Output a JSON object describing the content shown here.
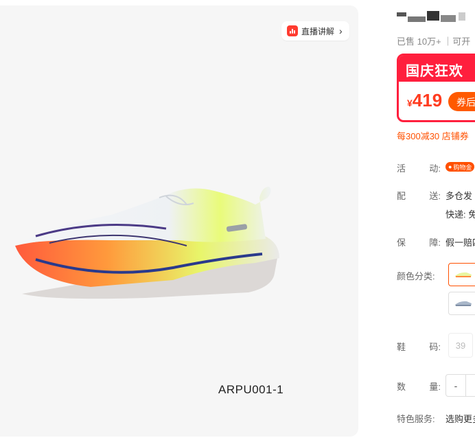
{
  "live_button": {
    "label": "直播讲解",
    "icon": "live-chart-icon",
    "arrow_icon": "chevron-right-icon"
  },
  "image": {
    "model_code": "ARPU001-1"
  },
  "product": {
    "sold": "已售 10万+ ｜可开",
    "promo_title": "国庆狂欢",
    "price_symbol": "¥",
    "price": "419",
    "coupon_label": "券后",
    "discount_text": "每300减30 店铺券"
  },
  "rows": {
    "activity": {
      "label_a": "活",
      "label_b": "动:",
      "tag": "购物金"
    },
    "shipping": {
      "label_a": "配",
      "label_b": "送:",
      "value": "多仓发",
      "value2": "快递: 免"
    },
    "guarantee": {
      "label_a": "保",
      "label_b": "障:",
      "value": "假一赔四"
    },
    "color": {
      "label": "颜色分类:"
    },
    "size": {
      "label_a": "鞋",
      "label_b": "码:",
      "option": "39"
    },
    "quantity": {
      "label_a": "数",
      "label_b": "量:",
      "minus": "-"
    },
    "service": {
      "label": "特色服务:",
      "value": "选购更多"
    }
  },
  "colors": {
    "accent": "#ff5000",
    "promo_red": "#ff1f3d"
  }
}
